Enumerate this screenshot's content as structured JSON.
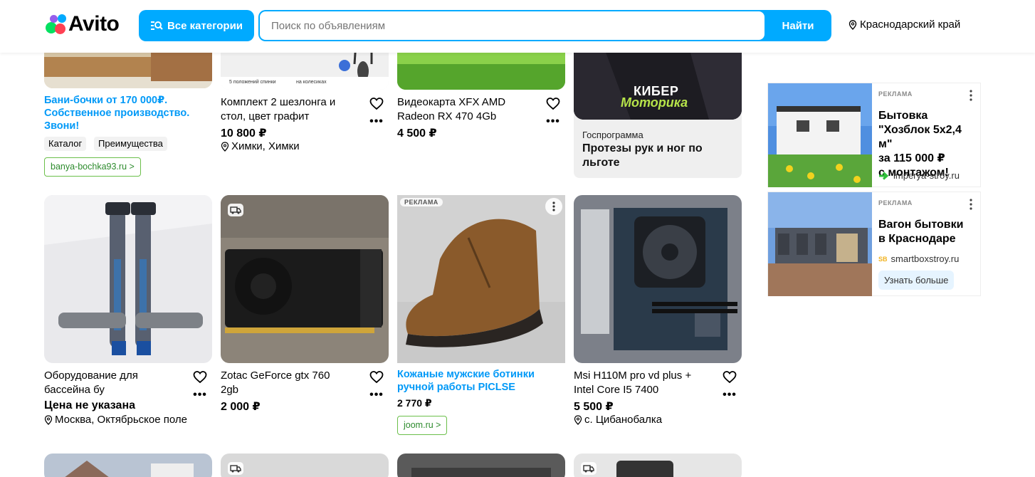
{
  "header": {
    "logo_text": "Avito",
    "categories_label": "Все категории",
    "search_placeholder": "Поиск по объявлениям",
    "search_button": "Найти",
    "region": "Краснодарский край"
  },
  "colors": {
    "accent": "#00aaff",
    "ad_title": "#0099f7",
    "link_green": "#2d8b2d"
  },
  "row1": [
    {
      "title_lines": [
        "Бани-бочки от 170 000₽.",
        "Собственное производство.",
        "Звони!"
      ],
      "chips": [
        "Каталог",
        "Преимущества"
      ],
      "link": "banya-bochka93.ru >"
    },
    {
      "title_lines": [
        "Комплект 2 шезлонга и",
        "стол, цвет графит"
      ],
      "price": "10 800 ₽",
      "location": "Химки, Химки",
      "img_tags": [
        "5 положений спинки",
        "на колесиках"
      ]
    },
    {
      "title_lines": [
        "Видеокарта XFX AMD",
        "Radeon RX 470 4Gb"
      ],
      "price": "4 500 ₽"
    },
    {
      "banner_line1": "КИБЕР",
      "banner_line2": "Моторика",
      "caption": "Госпрограмма",
      "headline_lines": [
        "Протезы рук и ног по",
        "льготе"
      ]
    }
  ],
  "row2": [
    {
      "title_lines": [
        "Оборудование для",
        "бассейна бу"
      ],
      "price": "Цена не указана",
      "location": "Москва, Октябрьское поле"
    },
    {
      "title_lines": [
        "Zotac GeForce gtx 760",
        "2gb"
      ],
      "price": "2 000 ₽"
    },
    {
      "badge": "РЕКЛАМА",
      "title_lines": [
        "Кожаные мужские ботинки",
        "ручной работы PICLSE"
      ],
      "price": "2 770 ₽",
      "link": "joom.ru >"
    },
    {
      "title_lines": [
        "Msi H110M pro vd plus +",
        "Intel Core I5 7400"
      ],
      "price": "5 500 ₽",
      "location": "с. Цибанобалка"
    }
  ],
  "side_ads": [
    {
      "tag": "РЕКЛАМА",
      "title_lines": [
        "Бытовка",
        "\"Хозблок 5х2,4 м\"",
        "за 115 000 ₽",
        "с монтажом!"
      ],
      "domain": "imperya-stroy.ru"
    },
    {
      "tag": "РЕКЛАМА",
      "title_lines": [
        "Вагон бытовки",
        "в Краснодаре"
      ],
      "domain": "smartboxstroy.ru",
      "domain_badge": "SB",
      "button": "Узнать больше"
    }
  ]
}
